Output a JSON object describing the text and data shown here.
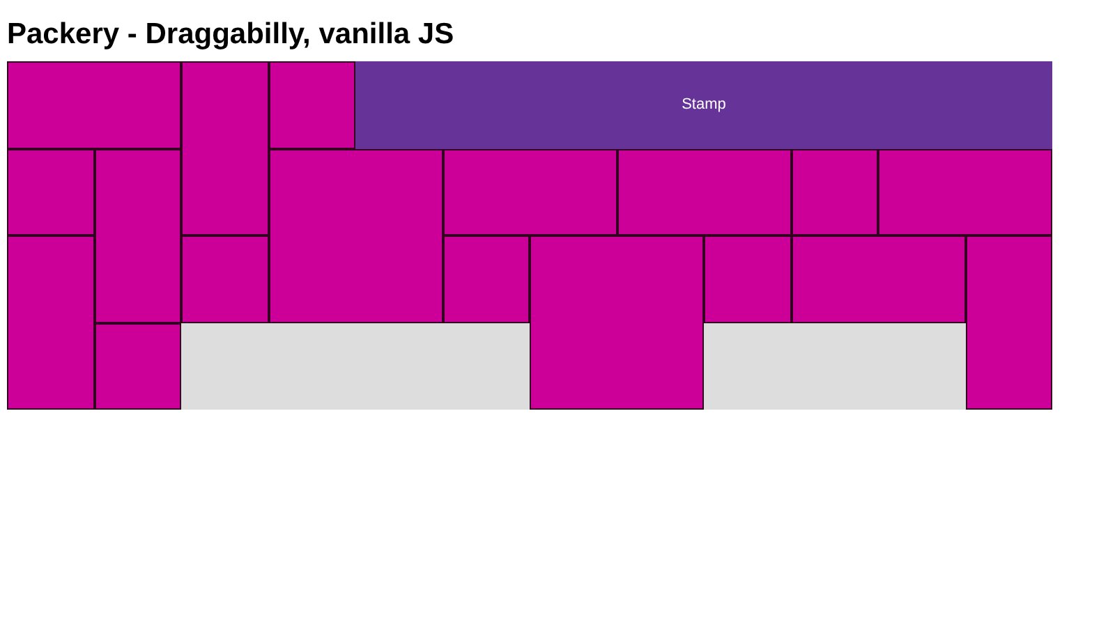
{
  "title": "Packery - Draggabilly, vanilla JS",
  "stamp": {
    "label": "Stamp"
  }
}
